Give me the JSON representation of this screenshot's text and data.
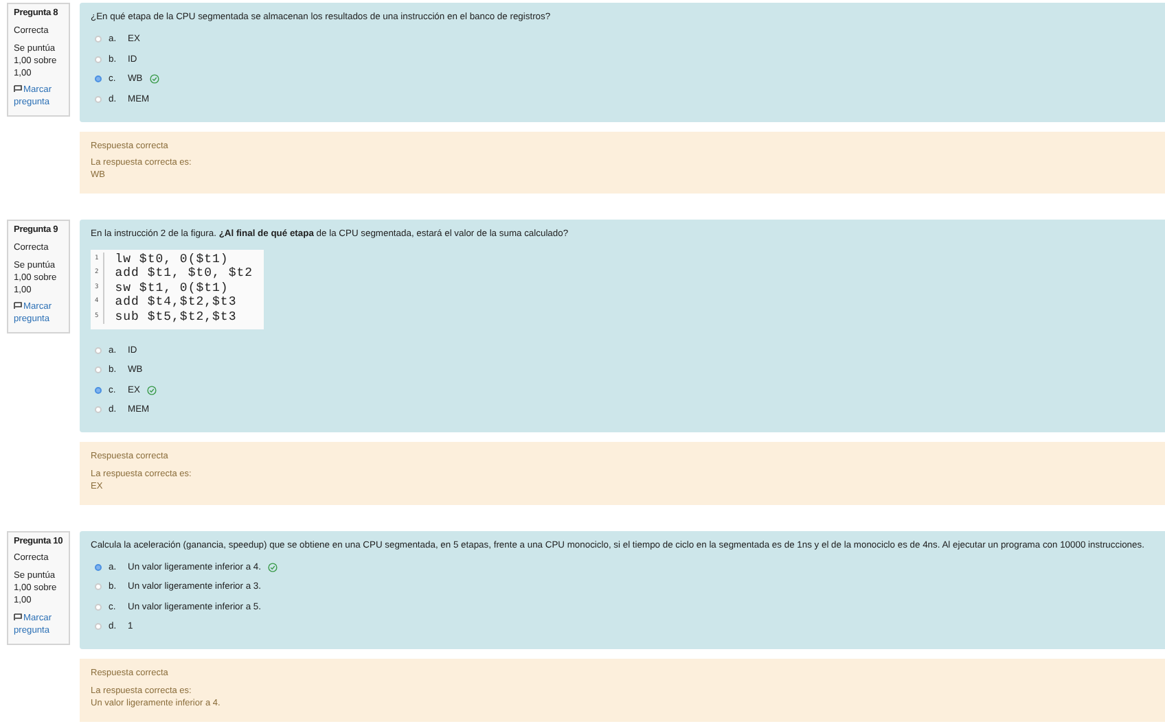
{
  "questions": [
    {
      "number": "Pregunta 8",
      "state": "Correcta",
      "grade": "Se puntúa 1,00 sobre 1,00",
      "flag": "Marcar pregunta",
      "text": "¿En qué etapa de la CPU segmentada se almacenan los resultados de una instrucción en el banco de registros?",
      "options": [
        {
          "letter": "a.",
          "text": "EX",
          "selected": false,
          "correct": false
        },
        {
          "letter": "b.",
          "text": "ID",
          "selected": false,
          "correct": false
        },
        {
          "letter": "c.",
          "text": "WB",
          "selected": true,
          "correct": true
        },
        {
          "letter": "d.",
          "text": "MEM",
          "selected": false,
          "correct": false
        }
      ],
      "feedback": {
        "status": "Respuesta correcta",
        "label": "La respuesta correcta es:",
        "answer": "WB"
      }
    },
    {
      "number": "Pregunta 9",
      "state": "Correcta",
      "grade": "Se puntúa 1,00 sobre 1,00",
      "flag": "Marcar pregunta",
      "text": "En la instrucción 2 de la figura. **¿Al final de qué etapa** de la CPU segmentada, estará el valor de la suma calculado?",
      "code": [
        {
          "num": "1",
          "line": "lw $t0, 0($t1)"
        },
        {
          "num": "2",
          "line": "add $t1, $t0, $t2"
        },
        {
          "num": "3",
          "line": "sw $t1, 0($t1)"
        },
        {
          "num": "4",
          "line": "add $t4,$t2,$t3"
        },
        {
          "num": "5",
          "line": "sub $t5,$t2,$t3"
        }
      ],
      "options": [
        {
          "letter": "a.",
          "text": "ID",
          "selected": false,
          "correct": false
        },
        {
          "letter": "b.",
          "text": "WB",
          "selected": false,
          "correct": false
        },
        {
          "letter": "c.",
          "text": "EX",
          "selected": true,
          "correct": true
        },
        {
          "letter": "d.",
          "text": "MEM",
          "selected": false,
          "correct": false
        }
      ],
      "feedback": {
        "status": "Respuesta correcta",
        "label": "La respuesta correcta es:",
        "answer": "EX"
      }
    },
    {
      "number": "Pregunta 10",
      "state": "Correcta",
      "grade": "Se puntúa 1,00 sobre 1,00",
      "flag": "Marcar pregunta",
      "text": "Calcula la aceleración (ganancia, speedup) que se obtiene en una CPU segmentada, en 5 etapas, frente a una CPU monociclo, si el tiempo de ciclo en la segmentada es de 1ns y el de la monociclo es de 4ns. Al ejecutar un programa con 10000 instrucciones.",
      "options": [
        {
          "letter": "a.",
          "text": "Un valor ligeramente inferior a 4.",
          "selected": true,
          "correct": true
        },
        {
          "letter": "b.",
          "text": "Un valor ligeramente inferior a 3.",
          "selected": false,
          "correct": false
        },
        {
          "letter": "c.",
          "text": "Un valor ligeramente inferior a 5.",
          "selected": false,
          "correct": false
        },
        {
          "letter": "d.",
          "text": "1",
          "selected": false,
          "correct": false
        }
      ],
      "feedback": {
        "status": "Respuesta correcta",
        "label": "La respuesta correcta es:",
        "answer": "Un valor ligeramente inferior a 4."
      }
    }
  ]
}
